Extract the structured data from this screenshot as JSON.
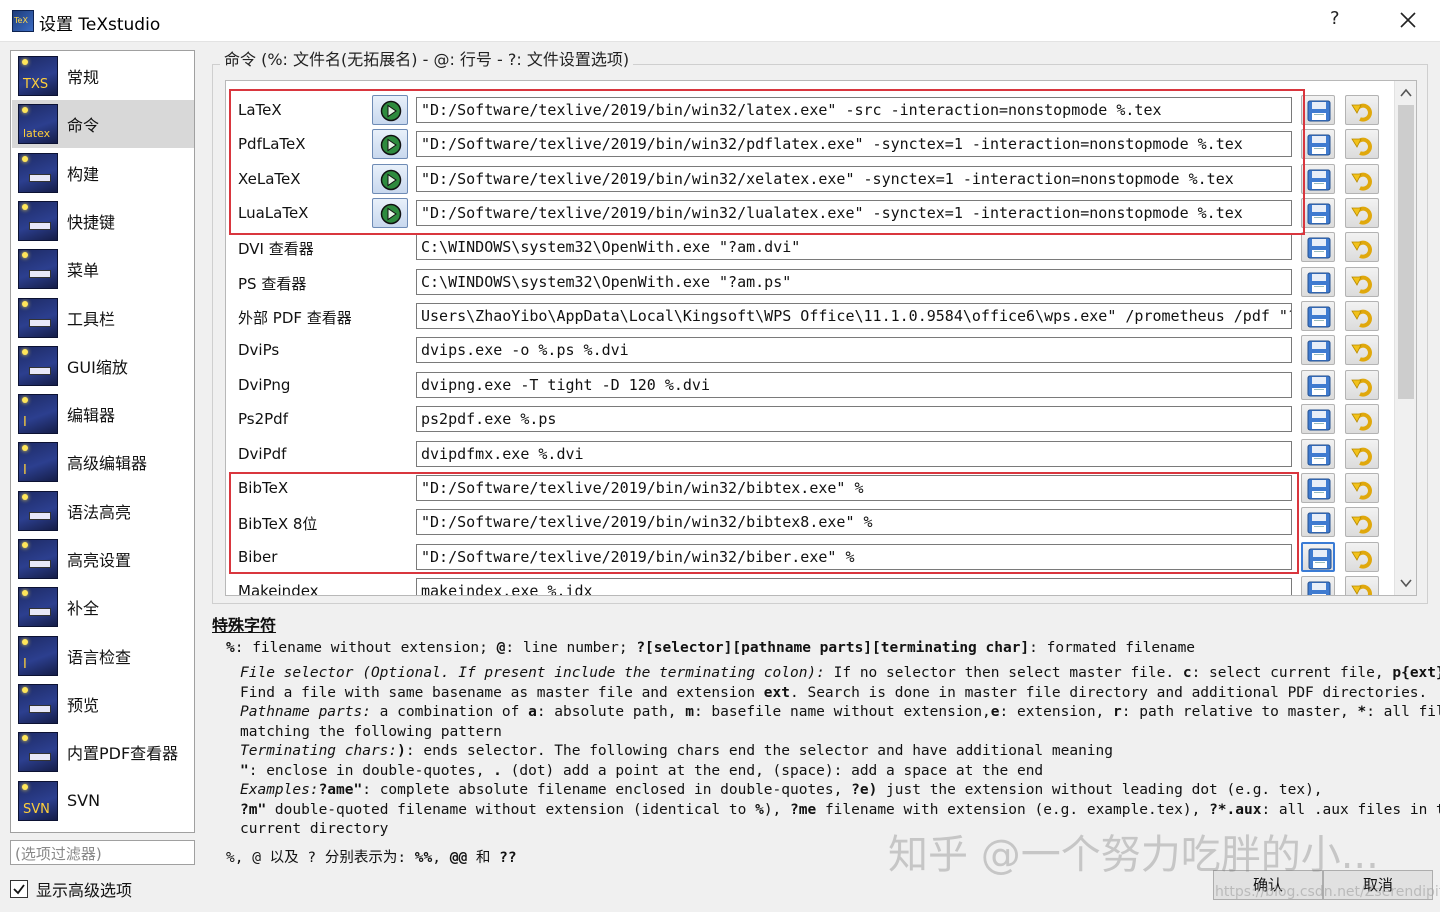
{
  "window": {
    "title": "设置 TeXstudio",
    "help": "?"
  },
  "sidebar": {
    "items": [
      {
        "label": "常规",
        "icon": "general-icon",
        "glyph": "TXS"
      },
      {
        "label": "命令",
        "icon": "commands-icon",
        "glyph": "latex"
      },
      {
        "label": "构建",
        "icon": "build-icon",
        "glyph": ""
      },
      {
        "label": "快捷键",
        "icon": "shortcuts-icon",
        "glyph": ""
      },
      {
        "label": "菜单",
        "icon": "menu-icon",
        "glyph": ""
      },
      {
        "label": "工具栏",
        "icon": "toolbar-icon",
        "glyph": ""
      },
      {
        "label": "GUI缩放",
        "icon": "gui-scale-icon",
        "glyph": ""
      },
      {
        "label": "编辑器",
        "icon": "editor-icon",
        "glyph": "I"
      },
      {
        "label": "高级编辑器",
        "icon": "advanced-editor-icon",
        "glyph": "I"
      },
      {
        "label": "语法高亮",
        "icon": "syntax-highlight-icon",
        "glyph": ""
      },
      {
        "label": "高亮设置",
        "icon": "highlight-settings-icon",
        "glyph": ""
      },
      {
        "label": "补全",
        "icon": "completion-icon",
        "glyph": ""
      },
      {
        "label": "语言检查",
        "icon": "language-check-icon",
        "glyph": "I"
      },
      {
        "label": "预览",
        "icon": "preview-icon",
        "glyph": ""
      },
      {
        "label": "内置PDF查看器",
        "icon": "pdf-viewer-icon",
        "glyph": ""
      },
      {
        "label": "SVN",
        "icon": "svn-icon",
        "glyph": "SVN"
      }
    ],
    "selected_index": 1,
    "filter_placeholder": "(选项过滤器)",
    "show_advanced_label": "显示高级选项",
    "show_advanced_checked": true
  },
  "commands": {
    "group_title": "命令 (%: 文件名(无拓展名) - @: 行号 - ?: 文件设置选项)",
    "rows": [
      {
        "label": "LaTeX",
        "value": "\"D:/Software/texlive/2019/bin/win32/latex.exe\" -src -interaction=nonstopmode %.tex",
        "has_run": true
      },
      {
        "label": "PdfLaTeX",
        "value": "\"D:/Software/texlive/2019/bin/win32/pdflatex.exe\" -synctex=1 -interaction=nonstopmode %.tex",
        "has_run": true
      },
      {
        "label": "XeLaTeX",
        "value": "\"D:/Software/texlive/2019/bin/win32/xelatex.exe\" -synctex=1 -interaction=nonstopmode %.tex",
        "has_run": true
      },
      {
        "label": "LuaLaTeX",
        "value": "\"D:/Software/texlive/2019/bin/win32/lualatex.exe\" -synctex=1 -interaction=nonstopmode %.tex",
        "has_run": true
      },
      {
        "label": "DVI 查看器",
        "value": "C:\\WINDOWS\\system32\\OpenWith.exe \"?am.dvi\"",
        "has_run": false
      },
      {
        "label": "PS 查看器",
        "value": "C:\\WINDOWS\\system32\\OpenWith.exe \"?am.ps\"",
        "has_run": false
      },
      {
        "label": "外部 PDF 查看器",
        "value": "Users\\ZhaoYibo\\AppData\\Local\\Kingsoft\\WPS Office\\11.1.0.9584\\office6\\wps.exe\" /prometheus /pdf \"?am.pdf\"",
        "has_run": false
      },
      {
        "label": "DviPs",
        "value": "dvips.exe -o %.ps %.dvi",
        "has_run": false
      },
      {
        "label": "DviPng",
        "value": "dvipng.exe -T tight -D 120 %.dvi",
        "has_run": false
      },
      {
        "label": "Ps2Pdf",
        "value": "ps2pdf.exe %.ps",
        "has_run": false
      },
      {
        "label": "DviPdf",
        "value": "dvipdfmx.exe %.dvi",
        "has_run": false
      },
      {
        "label": "BibTeX",
        "value": "\"D:/Software/texlive/2019/bin/win32/bibtex.exe\" %",
        "has_run": false
      },
      {
        "label": "BibTeX 8位",
        "value": "\"D:/Software/texlive/2019/bin/win32/bibtex8.exe\" %",
        "has_run": false
      },
      {
        "label": "Biber",
        "value": "\"D:/Software/texlive/2019/bin/win32/biber.exe\" %",
        "has_run": false
      },
      {
        "label": "Makeindex",
        "value": "makeindex.exe %.idx",
        "has_run": false
      }
    ],
    "scroll_position": 0
  },
  "special": {
    "title": "特殊字符",
    "l1": {
      "a": "%",
      "b": ": filename without extension; ",
      "c": "@",
      "d": ": line number; ",
      "e": "?[selector][pathname parts][terminating char]",
      "f": ": formated filename"
    },
    "l2": {
      "a": "File selector (Optional. If present include the terminating colon):",
      "b": " If no selector then select master file. ",
      "c": "c",
      "d": ": select current file, ",
      "e": "p{ext}",
      "f": ":"
    },
    "l3": {
      "a": "Find a file with same basename as master file and extension ",
      "b": "ext",
      "c": ". Search is done in master file directory and additional PDF directories."
    },
    "l4": {
      "a": "Pathname parts:",
      "b": " a combination of ",
      "c": "a",
      "d": ": absolute path, ",
      "e": "m",
      "f": ": basefile name without extension,",
      "g": "e",
      "h": ": extension, ",
      "i": "r",
      "j": ": path relative to master, ",
      "k": "*",
      "l": ": all files"
    },
    "l5": {
      "a": "matching the following pattern"
    },
    "l6": {
      "a": "Terminating chars:",
      "b": ")",
      "c": ": ends selector. The following chars end the selector and have additional meaning"
    },
    "l7": {
      "a": "\"",
      "b": ": enclose in double-quotes, ",
      "c": ".",
      "d": " (dot) add a point at the end, (space): add a space at the end"
    },
    "l8": {
      "a": "Examples:",
      "b": "?ame\"",
      "c": ": complete absolute filename enclosed in double-quotes, ",
      "d": "?e)",
      "e": " just the extension without leading dot (e.g. tex),"
    },
    "l9": {
      "a": "?m\"",
      "b": " double-quoted filename without extension (identical to ",
      "c": "%",
      "d": "), ",
      "e": "?me",
      "f": " filename with extension (e.g. example.tex), ",
      "g": "?*.aux",
      "h": ": all .aux files in the"
    },
    "l10": {
      "a": "current directory"
    },
    "l11": {
      "a": "%, @ 以及 ? 分别表示为: ",
      "b": "%%",
      "c": ", ",
      "d": "@@",
      "e": " 和 ",
      "f": "??"
    }
  },
  "buttons": {
    "ok": "确认",
    "cancel": "取消"
  },
  "watermark": {
    "main": "知乎 @一个努力吃胖的小...",
    "url": "https://blog.csdn.net/Zserendipity"
  },
  "colors": {
    "highlight": "#d9363e",
    "selected_bg": "#d8d8d8"
  }
}
